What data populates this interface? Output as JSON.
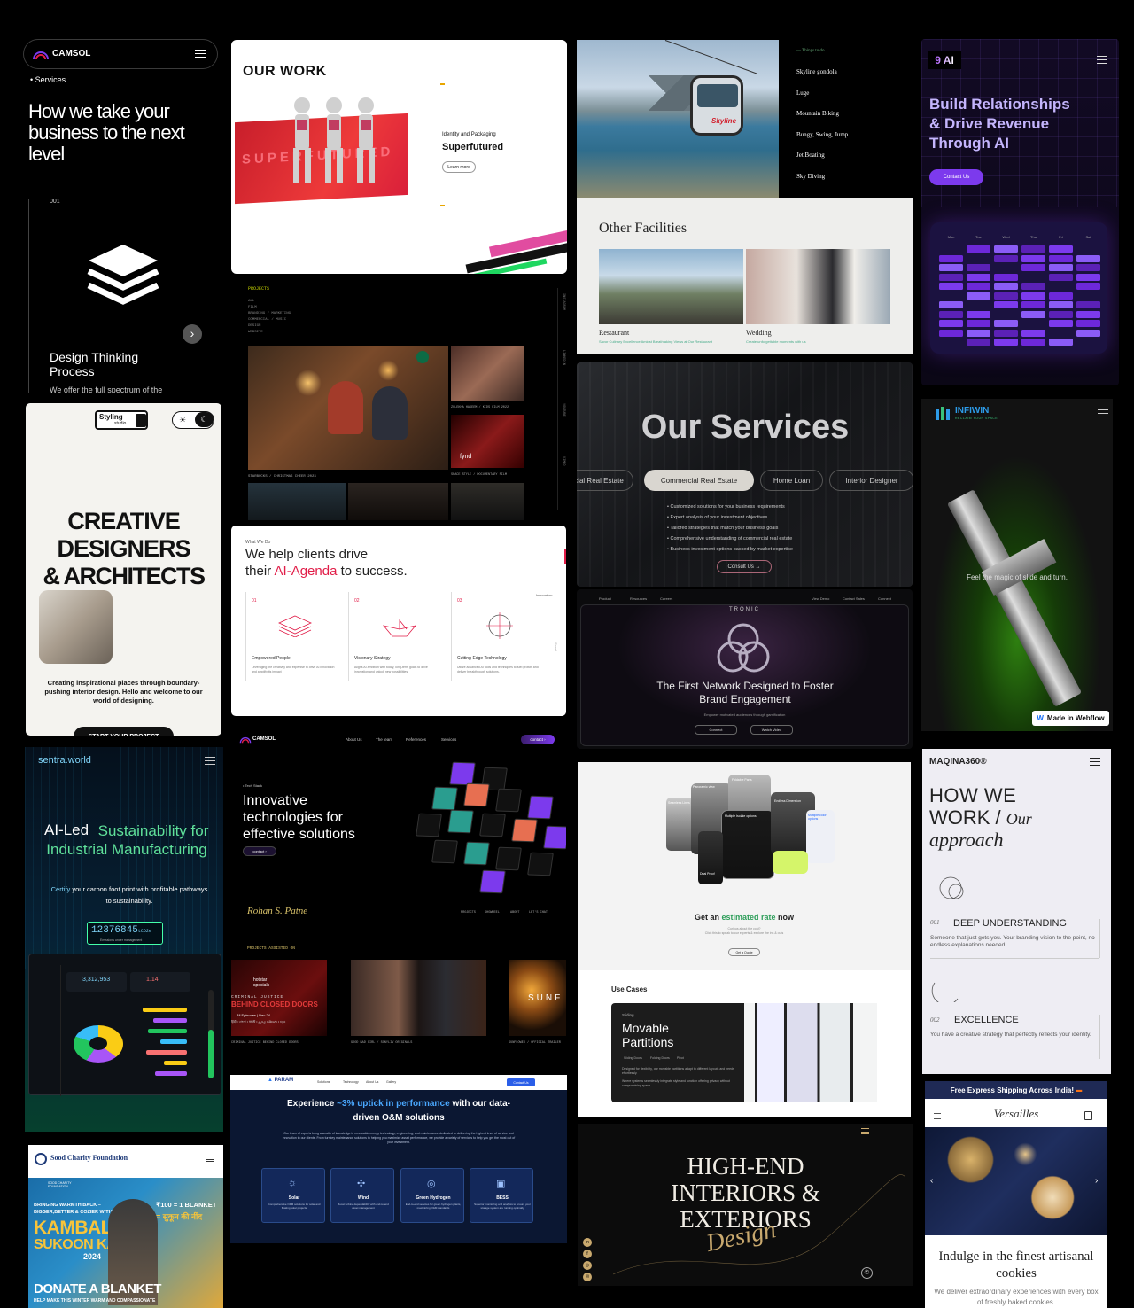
{
  "camsol1": {
    "brand": "CAMSOL",
    "nav": "Services",
    "headline": "How we take your business to the next level",
    "step": "001",
    "card_title": "Design Thinking Process",
    "card_text": "We offer the full spectrum of the"
  },
  "ourwork": {
    "title": "OUR WORK",
    "banner": "SUPERFUTURED",
    "category": "Identity and Packaging",
    "project": "Superfutured",
    "learn": "Learn more"
  },
  "skyline": {
    "menu_head": "Things to do",
    "menu": [
      "Skyline gondola",
      "Luge",
      "Mountain Biking",
      "Bungy, Swing, Jump",
      "Jet Boating",
      "Sky Diving"
    ],
    "badge": "Skyline",
    "facilities": "Other Facilities",
    "items": [
      {
        "name": "Restaurant",
        "desc": "Savor Culinary Excellence Amidst Breathtaking Views at Our Restaurant"
      },
      {
        "name": "Wedding",
        "desc": "Create unforgettable moments with us"
      }
    ]
  },
  "nineai": {
    "logo": "9 AI",
    "headline": "Build Relationships & Drive Revenue Through AI",
    "cta": "Contact Us",
    "days": [
      "Mon",
      "Tue",
      "Wed",
      "Thu",
      "Fri",
      "Sat"
    ]
  },
  "projects": {
    "label": "PROJECTS",
    "filters": [
      "ALL",
      "FILM",
      "BRANDING / MARKETING",
      "COMMERCIAL / MUSIC",
      "DESIGN",
      "WEBSITE"
    ],
    "captions": [
      "STARBUCKS / CHRISTMAS CHEER 2023",
      "ZULEKHA HAKEEM / KIDS FILM 2022",
      "SPACE STYLE / DOCUMENTARY FILM"
    ],
    "fynd": "fynd",
    "side": [
      "INSTAGRAM",
      "LINKEDIN",
      "YOUTUBE",
      "VIMEO"
    ]
  },
  "services": {
    "title": "Our Services",
    "tabs": [
      "cial Real Estate",
      "Commercial Real Estate",
      "Home Loan",
      "Interior Designer"
    ],
    "bullets": [
      "Customized solutions for your business requirements",
      "Expert analysis of your investment objectives",
      "Tailored strategies that match your business goals",
      "Comprehensive understanding of commercial real estate",
      "Business investment options backed by market expertise"
    ],
    "cta": "Consult Us"
  },
  "infiwin": {
    "brand": "INFIWIN",
    "tagline": "RECLAIM YOUR SPACE",
    "caption": "Feel the magic of slide and turn.",
    "webflow": "Made in Webflow"
  },
  "styling": {
    "logo": "Styling",
    "logo_sub": "studio",
    "headline": [
      "CREATIVE",
      "DESIGNERS",
      "& ARCHITECTS"
    ],
    "text": "Creating inspirational places through boundary-pushing interior design. Hello and welcome to our world of designing.",
    "cta": "START YOUR PROJECT"
  },
  "aiagenda": {
    "eyebrow": "What We Do",
    "line1": "We help clients drive",
    "line2_pre": "their ",
    "highlight": "AI-Agenda",
    "line2_post": " to success.",
    "cols": [
      {
        "num": "01",
        "title": "Empowered People",
        "text": "Leveraging the creativity and expertise to drive AI innovation and amplify its impact"
      },
      {
        "num": "02",
        "title": "Visionary Strategy",
        "text": "Aligns AI ambition with today, long-term goals to drive innovation and unlock new possibilities."
      },
      {
        "num": "03",
        "title": "Cutting-Edge Technology",
        "text": "Utilize advanced AI tools and techniques to fuel growth and deliver breakthrough solutions."
      }
    ],
    "side": "Innovation",
    "rail": "Scroll"
  },
  "tronic": {
    "nav": [
      "Product",
      "Resources",
      "Careers",
      "View Demo",
      "Contact Sales",
      "Connect"
    ],
    "brand": "TRONIC",
    "headline": "The First Network Designed to Foster Brand Engagement",
    "sub": "Empower motivated audiences through gamification",
    "btn1": "Connect",
    "btn2": "Watch Video"
  },
  "sentra": {
    "brand": "sentra.world",
    "h1": "AI-Led",
    "h2": "Sustainability for Industrial Manufacturing",
    "p_hi": "Certify",
    "p": " your carbon foot print with profitable pathways to sustainability.",
    "counter": "12376845",
    "unit": "tCO2e",
    "counter_sub": "Emissions under management",
    "stat1": "3,312,953",
    "stat2": "1.14"
  },
  "camsol2": {
    "brand": "CAMSOL",
    "nav": [
      "About Us",
      "The team",
      "References",
      "Services"
    ],
    "contact": "contact",
    "eyebrow": "Tech Stack",
    "headline": "Innovative technologies for effective solutions",
    "cta": "contact"
  },
  "maqina": {
    "brand": "MAQINA360®",
    "h1": "HOW WE",
    "h2": "WORK / ",
    "h2_script": "Our",
    "h3_script": "approach",
    "items": [
      {
        "num": "001",
        "title": "DEEP UNDERSTANDING",
        "text": "Someone that just gets you. Your branding vision to the point, no endless explanations needed."
      },
      {
        "num": "002",
        "title": "EXCELLENCE",
        "text": "You have a creative strategy that perfectly reflects your identity."
      }
    ]
  },
  "rohan": {
    "logo": "Rohan S. Patne",
    "nav": [
      "PROJECTS",
      "SHOWREEL",
      "ABOUT",
      "LET'S CHAT"
    ],
    "label": "PROJECTS ASSISTED ON",
    "cards": [
      "CRIMINAL JUSTICE BEHIND CLOSED DOORS",
      "GOOD BAD GIRL / SONYLIV ORIGINALS",
      "SUNFLOWER / OFFICIAL TRAILER"
    ],
    "hotstar": "hotstar specials",
    "poster": "BEHIND CLOSED DOORS",
    "poster_top": "CRIMINAL JUSTICE",
    "episodes": "All Episodes | Dec 24",
    "languages": "हिंदी • বাংলা • मराठी • தமிழ் • తెలుగు • ಕನ್ನಡ",
    "sunflower": "SUNF"
  },
  "partitions": {
    "labels": [
      "Panoramic view",
      "Foldable Parts",
      "Multiple Isolate options",
      "Endless Dimension",
      "Multiple color options",
      "Seamless Lines",
      "Dual Proof"
    ],
    "get": "Get an ",
    "get_hi": "estimated rate",
    "get_post": " now",
    "small1": "Curious about the cost?",
    "small2": "Click this to speak to our experts & explore the ins & outs",
    "btn": "Get a Quote",
    "usecases": "Use Cases",
    "slider": "Sliding",
    "uc_title": "Movable Partitions",
    "uc_tabs": [
      "Sliding Doors",
      "Folding Doors",
      "Pivot"
    ],
    "uc_text": "Designed for flexibility, our movable partitions adapt to different layouts and needs effortlessly.",
    "uc_text2": "Where systems seamlessly integrate style and function offering privacy without compromising space."
  },
  "param": {
    "brand": "PARAM",
    "nav": [
      "Solutions",
      "Technology",
      "About Us",
      "Gallery"
    ],
    "contact": "Contact Us",
    "h_pre": "Experience ",
    "h_hi": "~3% uptick in performance",
    "h_post": " with our data-driven O&M solutions",
    "p": "Our team of experts bring a wealth of knowledge in renewable energy technology, engineering, and maintenance dedicated to delivering the highest level of service and innovation to our clients. From turnkey maintenance solutions to helping you maximize asset performance, we provide a variety of services to help you get the most out of your investment.",
    "cards": [
      {
        "t": "Solar",
        "d": "Comprehensive O&M solutions for solar and floating solar projects"
      },
      {
        "t": "Wind",
        "d": "Boost turbine dependability with end-to-end asset management"
      },
      {
        "t": "Green Hydrogen",
        "d": "End-to-end services for green hydrogen plants, maximizing O&M standards"
      },
      {
        "t": "BESS",
        "d": "Superior monitoring and analysis to ensure your storage system are running optimally"
      }
    ]
  },
  "sood": {
    "brand": "Sood Charity Foundation",
    "org": "SOOD CHARITY FOUNDATION",
    "l1": "BRINGING WARMTH BACK –",
    "l2": "BIGGER,BETTER & COZIER WITH",
    "kambal": "KAMBAL",
    "sukoon": "SUKOON KA",
    "year": "2024",
    "rate": "₹100 = 1 BLANKET",
    "hindi": "= सुकून की नींद",
    "donate": "DONATE A BLANKET",
    "help": "HELP MAKE THIS WINTER WARM AND COMPASSIONATE"
  },
  "interiors": {
    "h": [
      "HIGH-END",
      "INTERIORS &",
      "EXTERIORS"
    ],
    "script": "Design"
  },
  "versailles": {
    "bar": "Free Express Shipping Across India!",
    "brand": "Versailles",
    "h": "Indulge in the finest artisanal cookies",
    "p": "We deliver extraordinary experiences with every box of freshly baked cookies."
  },
  "colors": {
    "bg": "#000000",
    "purple": "#7c3aed",
    "red_accent": "#e11d48",
    "green": "#22c55e",
    "gold": "#c9a96e"
  }
}
